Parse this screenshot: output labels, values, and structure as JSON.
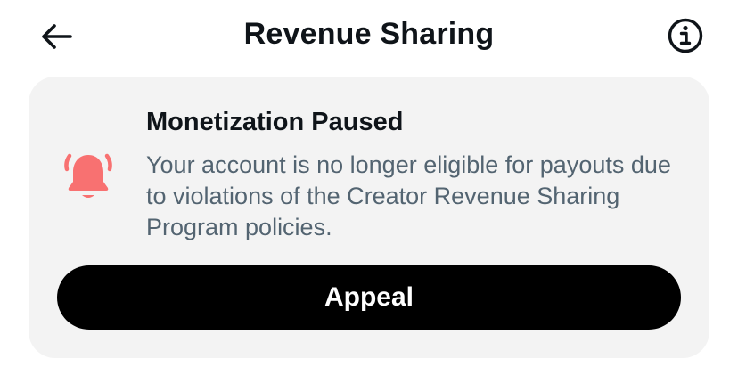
{
  "header": {
    "title": "Revenue Sharing",
    "back_icon": "arrow-left-icon",
    "info_icon": "info-circle-icon"
  },
  "notice": {
    "icon": "alarm-bell-icon",
    "icon_color": "#f87171",
    "title": "Monetization Paused",
    "message": "Your account is no longer eligible for payouts due to violations of the Creator Revenue Sharing Program policies.",
    "button_label": "Appeal"
  },
  "colors": {
    "card_background": "#f3f3f3",
    "button_background": "#000000",
    "secondary_text": "#536471"
  }
}
